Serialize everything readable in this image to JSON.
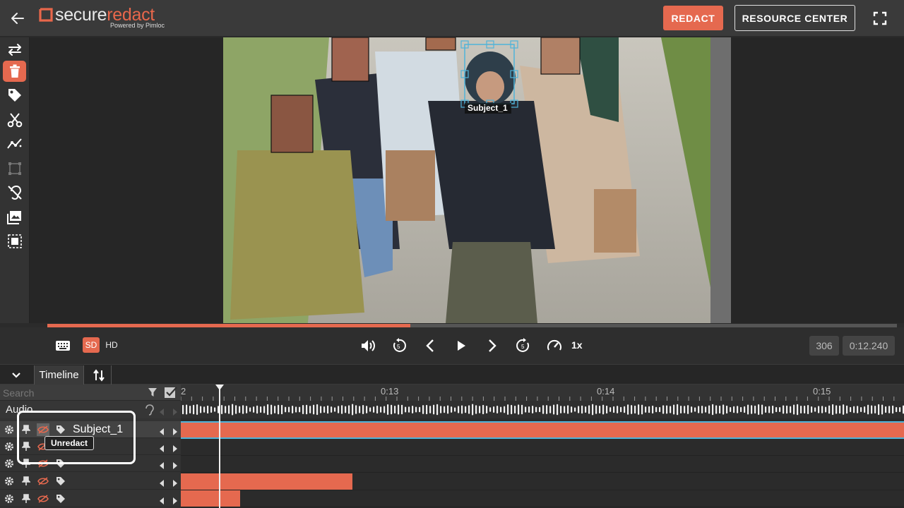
{
  "header": {
    "brand_part1": "secure",
    "brand_part2": "redact",
    "brand_sub": "Powered by Pimloc",
    "redact_label": "REDACT",
    "resource_label": "RESOURCE CENTER"
  },
  "toolbar": {
    "icons": [
      "swap-icon",
      "trash-icon",
      "tag-icon",
      "scissors-icon",
      "tracking-icon",
      "bounding-box-icon",
      "hearing-off-icon",
      "image-icon",
      "select-area-icon"
    ],
    "active": "trash-icon"
  },
  "video": {
    "subject_label": "Subject_1",
    "progress": 0.427
  },
  "controls": {
    "sd_label": "SD",
    "hd_label": "HD",
    "speed": "1x",
    "frame": "306",
    "time": "0:12.240"
  },
  "timeline": {
    "tab_label": "Timeline",
    "search_placeholder": "Search",
    "audio_label": "Audio",
    "tick_labels": [
      "2",
      "0:13",
      "0:14",
      "0:15"
    ],
    "tracks": [
      {
        "name": "Subject_1",
        "selected": true
      },
      {
        "name": "",
        "selected": false
      },
      {
        "name": "",
        "selected": false
      },
      {
        "name": "",
        "selected": false
      },
      {
        "name": "",
        "selected": false
      }
    ],
    "tooltip": "Unredact"
  },
  "colors": {
    "accent": "#e5694f",
    "selection": "#4fb3d9"
  }
}
